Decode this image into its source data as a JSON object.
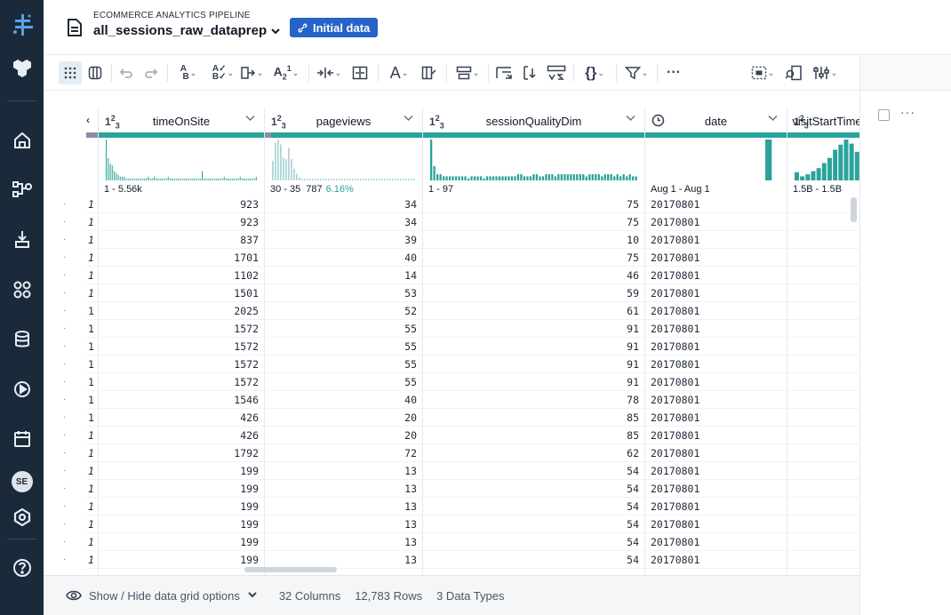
{
  "header": {
    "pipeline_label": "ECOMMERCE ANALYTICS PIPELINE",
    "dataset_name": "all_sessions_raw_dataprep",
    "initial_data_label": "Initial data"
  },
  "nav": {
    "avatar_initials": "SE"
  },
  "toolbar": {
    "more_label": "···"
  },
  "grid": {
    "columns": [
      {
        "name": "timeOnSite",
        "type": "integer",
        "range": "1 - 5.56k",
        "range_extra": "",
        "hist": [
          22,
          12,
          9,
          8,
          5,
          4,
          3,
          2,
          2,
          2,
          1,
          1,
          1,
          1,
          1,
          1,
          1,
          1,
          1,
          1,
          1,
          2,
          1,
          1,
          2,
          1,
          1,
          1,
          1,
          1,
          1,
          2,
          1,
          1,
          1,
          1,
          1,
          1,
          1,
          1,
          1,
          1,
          1,
          1,
          1,
          1,
          1,
          1,
          5,
          1,
          1,
          1,
          1,
          1,
          1,
          1,
          1,
          1,
          1,
          2,
          1,
          1,
          1,
          1,
          1,
          1,
          1,
          2,
          1,
          1,
          1,
          1,
          1,
          1,
          1,
          2
        ]
      },
      {
        "name": "pageviews",
        "type": "integer",
        "range": "30 - 35",
        "range_extra": "787",
        "range_pct": "6.16%",
        "hist": [
          12,
          23,
          25,
          22,
          14,
          13,
          20,
          13,
          7,
          4,
          2,
          1,
          1,
          1,
          1,
          1,
          1,
          1,
          1,
          1,
          1,
          1,
          1,
          1,
          1,
          1,
          1,
          1,
          1,
          1,
          1,
          1,
          1,
          1,
          1,
          1,
          1,
          1,
          1,
          1,
          1,
          1,
          1,
          1,
          1,
          1,
          1,
          1,
          1,
          1,
          1,
          1,
          1,
          1
        ]
      },
      {
        "name": "sessionQualityDim",
        "type": "integer",
        "range": "1 - 97",
        "range_extra": "",
        "hist": [
          20,
          7,
          3,
          3,
          2,
          2,
          2,
          2,
          2,
          2,
          2,
          2,
          1,
          2,
          2,
          2,
          2,
          1,
          2,
          2,
          2,
          2,
          2,
          2,
          2,
          2,
          2,
          2,
          3,
          3,
          2,
          2,
          2,
          3,
          3,
          2,
          2,
          3,
          3,
          3,
          2,
          3,
          3,
          3,
          3,
          3,
          3,
          3,
          3,
          3,
          2,
          3,
          3,
          3,
          3,
          2,
          3,
          3,
          3,
          2,
          3,
          2,
          3,
          2,
          3,
          2,
          2
        ]
      },
      {
        "name": "date",
        "type": "date",
        "range": "Aug 1 - Aug 1",
        "range_extra": "",
        "hist": [
          0,
          0,
          0,
          0,
          0,
          0,
          0,
          0,
          0,
          0,
          0,
          0,
          0,
          0,
          0,
          40,
          0
        ]
      },
      {
        "name": "visitStartTime",
        "type": "integer",
        "range": "1.5B - 1.5B",
        "range_extra": "",
        "hist": [
          8,
          4,
          6,
          9,
          12,
          17,
          22,
          30,
          35,
          40,
          36,
          28
        ]
      }
    ],
    "first_col_values": [
      "1",
      "1",
      "1",
      "1",
      "1",
      "1",
      "1",
      "1",
      "1",
      "1",
      "1",
      "1",
      "1",
      "1",
      "1",
      "1",
      "1",
      "1",
      "1",
      "1",
      "1"
    ],
    "rows": [
      [
        "923",
        "34",
        "75",
        "20170801"
      ],
      [
        "923",
        "34",
        "75",
        "20170801"
      ],
      [
        "837",
        "39",
        "10",
        "20170801"
      ],
      [
        "1701",
        "40",
        "75",
        "20170801"
      ],
      [
        "1102",
        "14",
        "46",
        "20170801"
      ],
      [
        "1501",
        "53",
        "59",
        "20170801"
      ],
      [
        "2025",
        "52",
        "61",
        "20170801"
      ],
      [
        "1572",
        "55",
        "91",
        "20170801"
      ],
      [
        "1572",
        "55",
        "91",
        "20170801"
      ],
      [
        "1572",
        "55",
        "91",
        "20170801"
      ],
      [
        "1572",
        "55",
        "91",
        "20170801"
      ],
      [
        "1546",
        "40",
        "78",
        "20170801"
      ],
      [
        "426",
        "20",
        "85",
        "20170801"
      ],
      [
        "426",
        "20",
        "85",
        "20170801"
      ],
      [
        "1792",
        "72",
        "62",
        "20170801"
      ],
      [
        "199",
        "13",
        "54",
        "20170801"
      ],
      [
        "199",
        "13",
        "54",
        "20170801"
      ],
      [
        "199",
        "13",
        "54",
        "20170801"
      ],
      [
        "199",
        "13",
        "54",
        "20170801"
      ],
      [
        "199",
        "13",
        "54",
        "20170801"
      ],
      [
        "199",
        "13",
        "54",
        "20170801"
      ]
    ]
  },
  "footer": {
    "toggle_label": "Show / Hide data grid options",
    "columns_count": "32 Columns",
    "rows_count": "12,783 Rows",
    "data_types": "3 Data Types"
  },
  "colors": {
    "rail": "#1b2a3a",
    "teal": "#2aa39b",
    "primary_button": "#2563c9"
  }
}
